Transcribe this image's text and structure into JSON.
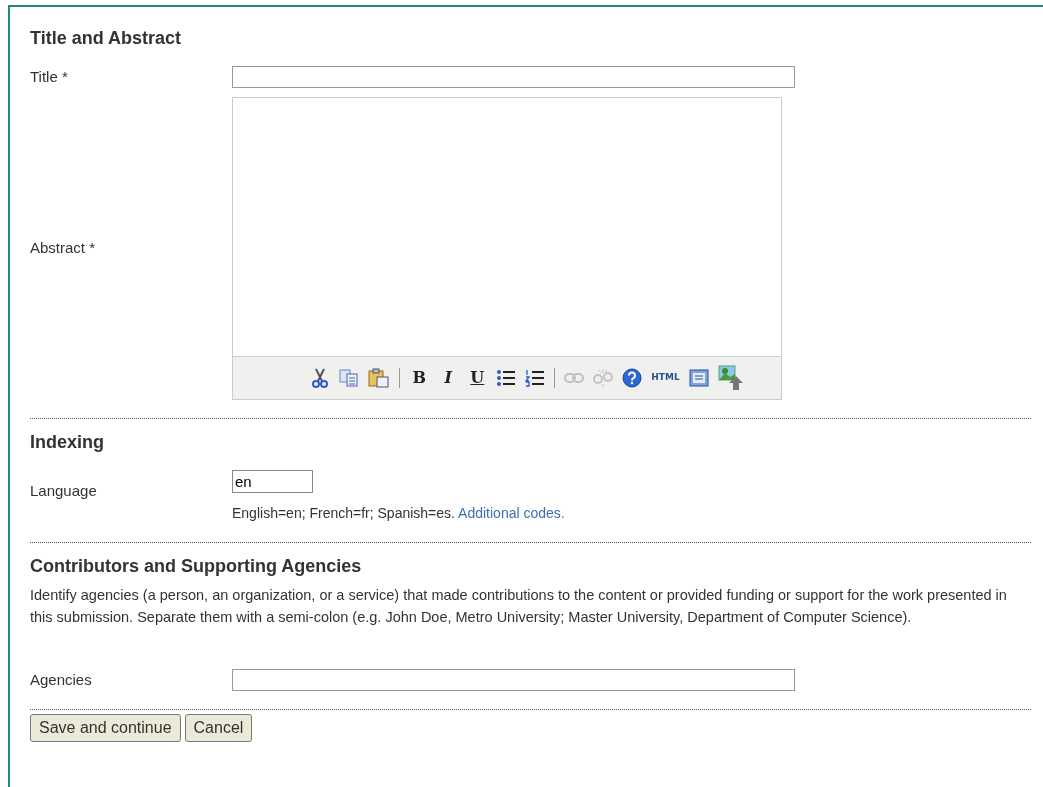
{
  "sections": [
    {
      "heading": "Title and Abstract",
      "fields": [
        {
          "kind": "text",
          "label": "Title *"
        },
        {
          "kind": "editor",
          "label": "Abstract *",
          "toolbar": [
            {
              "kind": "cut",
              "disabled": false
            },
            {
              "kind": "copy",
              "disabled": false
            },
            {
              "kind": "paste",
              "disabled": false
            },
            {
              "kind": "separator"
            },
            {
              "kind": "bold",
              "glyph": "B",
              "disabled": false
            },
            {
              "kind": "italic",
              "glyph": "I",
              "disabled": false
            },
            {
              "kind": "underline",
              "glyph": "U",
              "disabled": false
            },
            {
              "kind": "bullets",
              "disabled": false
            },
            {
              "kind": "numbers",
              "disabled": false
            },
            {
              "kind": "separator"
            },
            {
              "kind": "link",
              "disabled": true
            },
            {
              "kind": "unlink",
              "disabled": true
            },
            {
              "kind": "help",
              "disabled": false
            },
            {
              "kind": "html",
              "glyph": "HTML",
              "disabled": false
            },
            {
              "kind": "fullscreen",
              "disabled": false
            },
            {
              "kind": "image",
              "disabled": false
            }
          ]
        }
      ]
    },
    {
      "heading": "Indexing",
      "fields": [
        {
          "kind": "small",
          "label": "Language",
          "value": "en",
          "hint": "English=en; French=fr; Spanish=es.",
          "hint_link": "Additional codes."
        }
      ]
    },
    {
      "heading": "Contributors and Supporting Agencies",
      "description": "Identify agencies (a person, an organization, or a service) that made contributions to the content or provided funding or support for the work presented in this submission. Separate them with a semi-colon (e.g. John Doe, Metro University; Master University, Department of Computer Science).",
      "fields": [
        {
          "kind": "text",
          "label": "Agencies"
        }
      ]
    }
  ],
  "buttons": [
    "Save and continue",
    "Cancel"
  ]
}
